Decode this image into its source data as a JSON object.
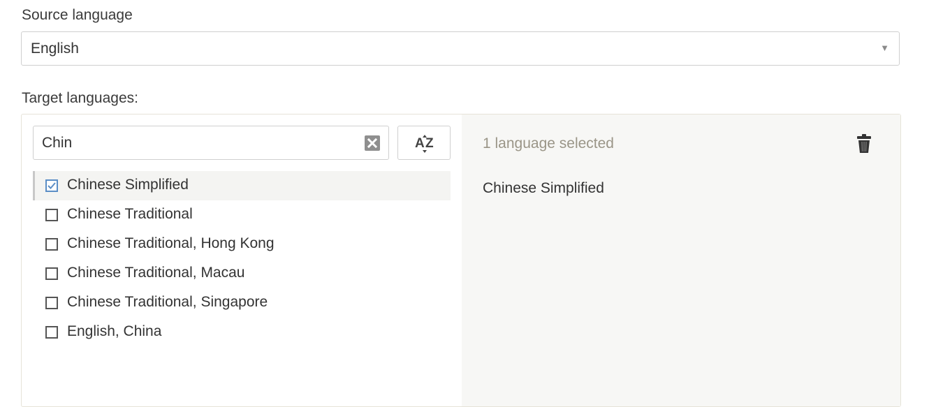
{
  "source": {
    "label": "Source language",
    "value": "English"
  },
  "target": {
    "label": "Target languages:",
    "search_value": "Chin",
    "items": [
      {
        "label": "Chinese Simplified",
        "checked": true
      },
      {
        "label": "Chinese Traditional",
        "checked": false
      },
      {
        "label": "Chinese Traditional, Hong Kong",
        "checked": false
      },
      {
        "label": "Chinese Traditional, Macau",
        "checked": false
      },
      {
        "label": "Chinese Traditional, Singapore",
        "checked": false
      },
      {
        "label": "English, China",
        "checked": false
      }
    ],
    "selected_count_text": "1 language selected",
    "selected": [
      "Chinese Simplified"
    ]
  },
  "icons": {
    "dropdown": "caret-down-icon",
    "clear": "clear-x-icon",
    "sort": "sort-az-icon",
    "delete": "trash-icon"
  },
  "colors": {
    "checkbox_checked": "#5b8ec6",
    "right_pane_bg": "#f7f7f5",
    "muted_text": "#9a9587"
  }
}
